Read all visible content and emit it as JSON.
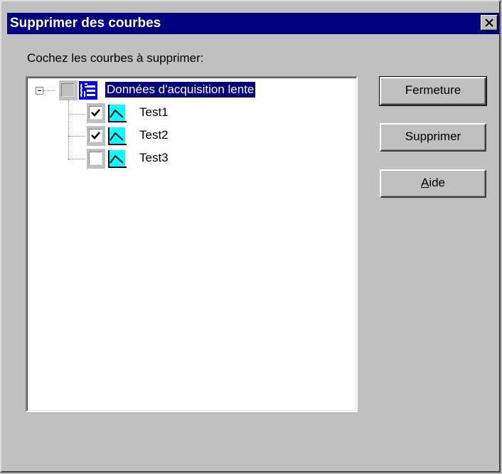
{
  "window": {
    "title": "Supprimer des courbes"
  },
  "instruction": "Cochez les courbes à supprimer:",
  "tree": {
    "root": {
      "label": "Données d'acquisition lente",
      "checked": false,
      "expanded": true,
      "icon": "data-folder-icon"
    },
    "children": [
      {
        "label": "Test1",
        "checked": true,
        "icon": "curve-icon"
      },
      {
        "label": "Test2",
        "checked": true,
        "icon": "curve-icon"
      },
      {
        "label": "Test3",
        "checked": false,
        "icon": "curve-icon"
      }
    ]
  },
  "buttons": {
    "close": "Fermeture",
    "delete": "Supprimer",
    "help_mnemonic": "A",
    "help_rest": "ide"
  },
  "colors": {
    "titlebar": "#000080",
    "selection": "#000080",
    "icon_cyan": "#00ffff",
    "face": "#c0c0c0"
  }
}
